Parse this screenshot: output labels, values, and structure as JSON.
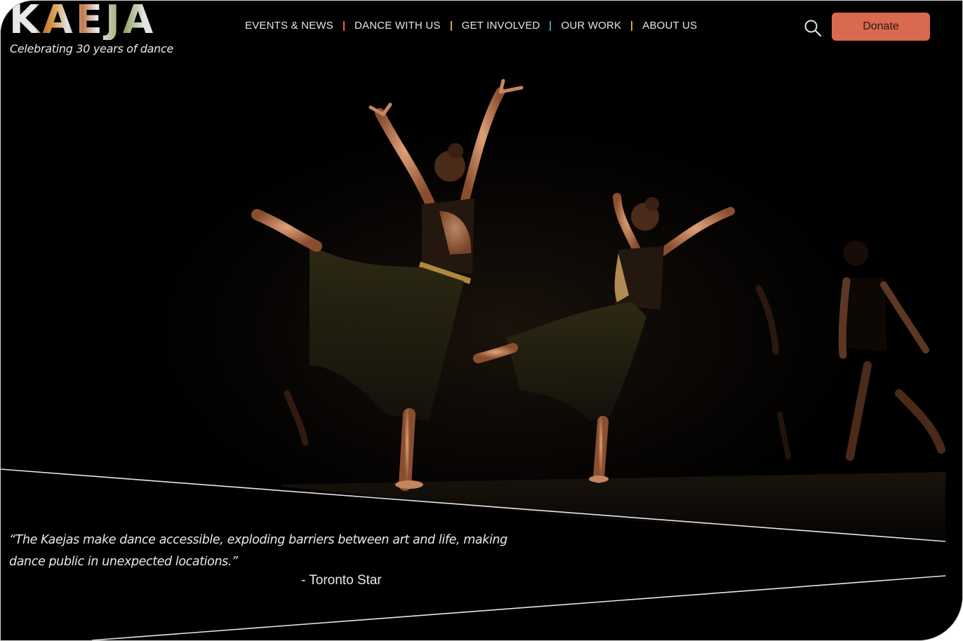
{
  "brand": {
    "logo_text": "KAEJA",
    "tagline": "Celebrating 30 years of dance"
  },
  "nav": {
    "items": [
      {
        "label": "EVENTS & NEWS"
      },
      {
        "label": "DANCE WITH US"
      },
      {
        "label": "GET INVOLVED"
      },
      {
        "label": "OUR WORK"
      },
      {
        "label": "ABOUT US"
      }
    ],
    "separator_colors": [
      "#e0703a",
      "#e0a03a",
      "#3aa0a8",
      "#e0a03a"
    ]
  },
  "header": {
    "search_icon": "search-icon",
    "donate_label": "Donate"
  },
  "hero": {
    "quote": "“The Kaejas make dance accessible, exploding barriers between art and life, making dance public in unexpected locations.”",
    "attribution": "- Toronto Star"
  },
  "colors": {
    "accent": "#d9694f",
    "background": "#000000",
    "text": "#e9e9e9"
  }
}
